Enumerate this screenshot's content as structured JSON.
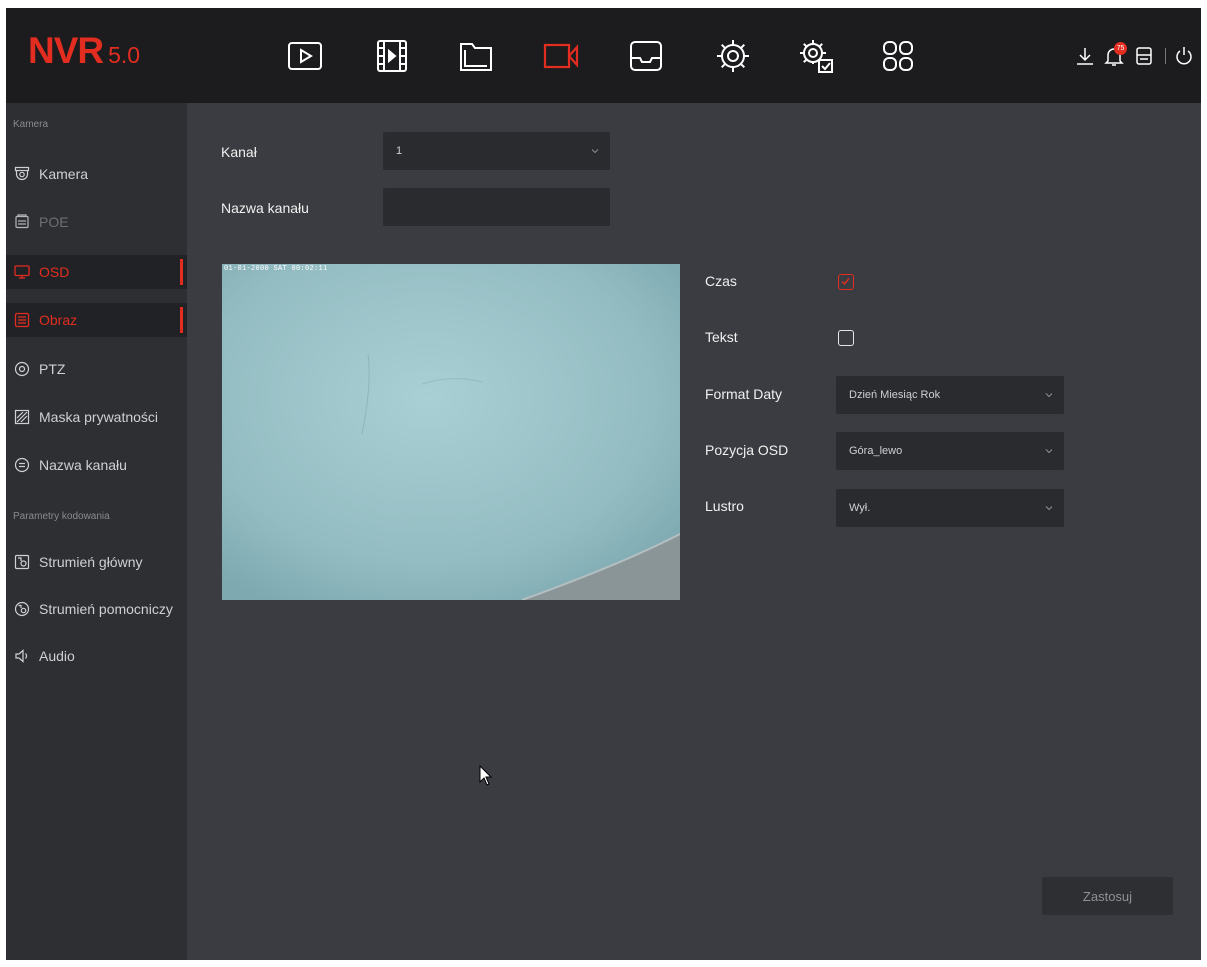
{
  "app": {
    "brand": "NVR",
    "version": "5.0"
  },
  "colors": {
    "accent": "#e22d20",
    "topbar": "#1c1c1e",
    "sidebar": "#2e2f33",
    "main": "#3a3c41",
    "field": "#2a2b2f"
  },
  "toolbar": {
    "icons": [
      "playback-icon",
      "video-clips-icon",
      "files-icon",
      "camera-icon",
      "storage-icon",
      "system-settings-icon",
      "advanced-settings-icon",
      "apps-grid-icon"
    ],
    "active_icon": "camera-icon",
    "system_icons": [
      "download-icon",
      "alarm-bell-icon",
      "hdd-icon",
      "power-icon"
    ],
    "alarm_count": "75"
  },
  "sidebar": {
    "section_camera": "Kamera",
    "section_encoding": "Parametry kodowania",
    "items": [
      {
        "label": "Kamera",
        "icon": "dome-camera-icon",
        "state": "normal"
      },
      {
        "label": "POE",
        "icon": "poe-icon",
        "state": "disabled"
      },
      {
        "label": "OSD",
        "icon": "monitor-icon",
        "state": "active"
      },
      {
        "label": "Obraz",
        "icon": "image-settings-icon",
        "state": "active"
      },
      {
        "label": "PTZ",
        "icon": "ptz-icon",
        "state": "normal"
      },
      {
        "label": "Maska prywatności",
        "icon": "privacy-mask-icon",
        "state": "normal"
      },
      {
        "label": "Nazwa kanału",
        "icon": "channel-name-icon",
        "state": "normal"
      },
      {
        "label": "Strumień główny",
        "icon": "main-stream-icon",
        "state": "normal"
      },
      {
        "label": "Strumień pomocniczy",
        "icon": "sub-stream-icon",
        "state": "normal"
      },
      {
        "label": "Audio",
        "icon": "speaker-icon",
        "state": "normal"
      }
    ]
  },
  "form": {
    "channel_label": "Kanał",
    "channel_value": "1",
    "channel_name_label": "Nazwa kanału",
    "channel_name_value": "",
    "time_label": "Czas",
    "time_checked": true,
    "text_label": "Tekst",
    "text_checked": false,
    "date_format_label": "Format Daty",
    "date_format_value": "Dzień Miesiąc Rok",
    "osd_position_label": "Pozycja OSD",
    "osd_position_value": "Góra_lewo",
    "mirror_label": "Lustro",
    "mirror_value": "Wył."
  },
  "preview": {
    "osd_text": "01-01-2000 SAT 00:02:11"
  },
  "apply_label": "Zastosuj"
}
